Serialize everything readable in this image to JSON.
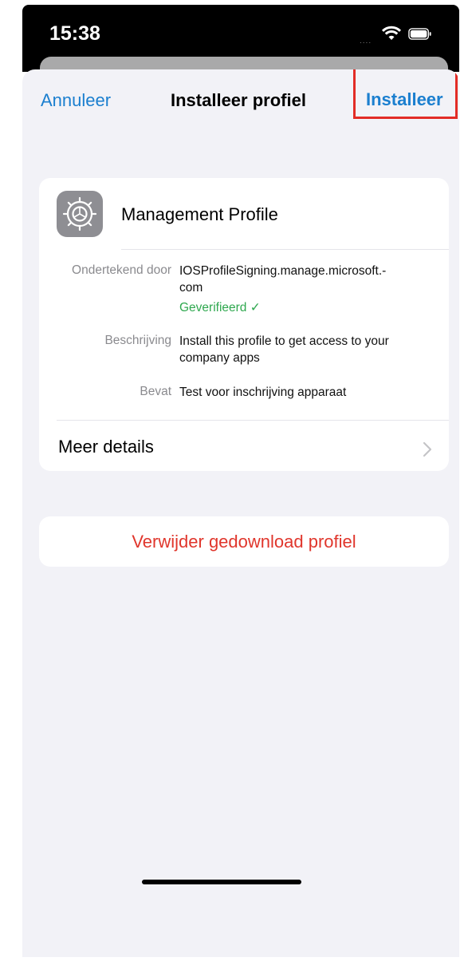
{
  "status": {
    "time": "15:38",
    "signal": "....",
    "icons": [
      "wifi-icon",
      "battery-icon"
    ]
  },
  "nav": {
    "cancel_label": "Annuleer",
    "title": "Installeer profiel",
    "install_label": "Installeer"
  },
  "profile": {
    "name": "Management Profile",
    "icon": "settings-gear-icon",
    "rows": [
      {
        "label": "Ondertekend door",
        "value_line1": "IOSProfileSigning.manage.microsoft.-",
        "value_line2": "com",
        "status": "Geverifieerd ✓"
      },
      {
        "label": "Beschrijving",
        "value_line1": "Install this profile to get access to your",
        "value_line2": "company apps"
      },
      {
        "label": "Bevat",
        "value_line1": "Test voor inschrijving apparaat"
      }
    ],
    "more_details_label": "Meer details"
  },
  "delete": {
    "label": "Verwijder gedownload profiel"
  },
  "colors": {
    "accent": "#1b7fcf",
    "destructive": "#e0362c",
    "verified": "#2fa84f",
    "highlight": "#e22c26"
  }
}
